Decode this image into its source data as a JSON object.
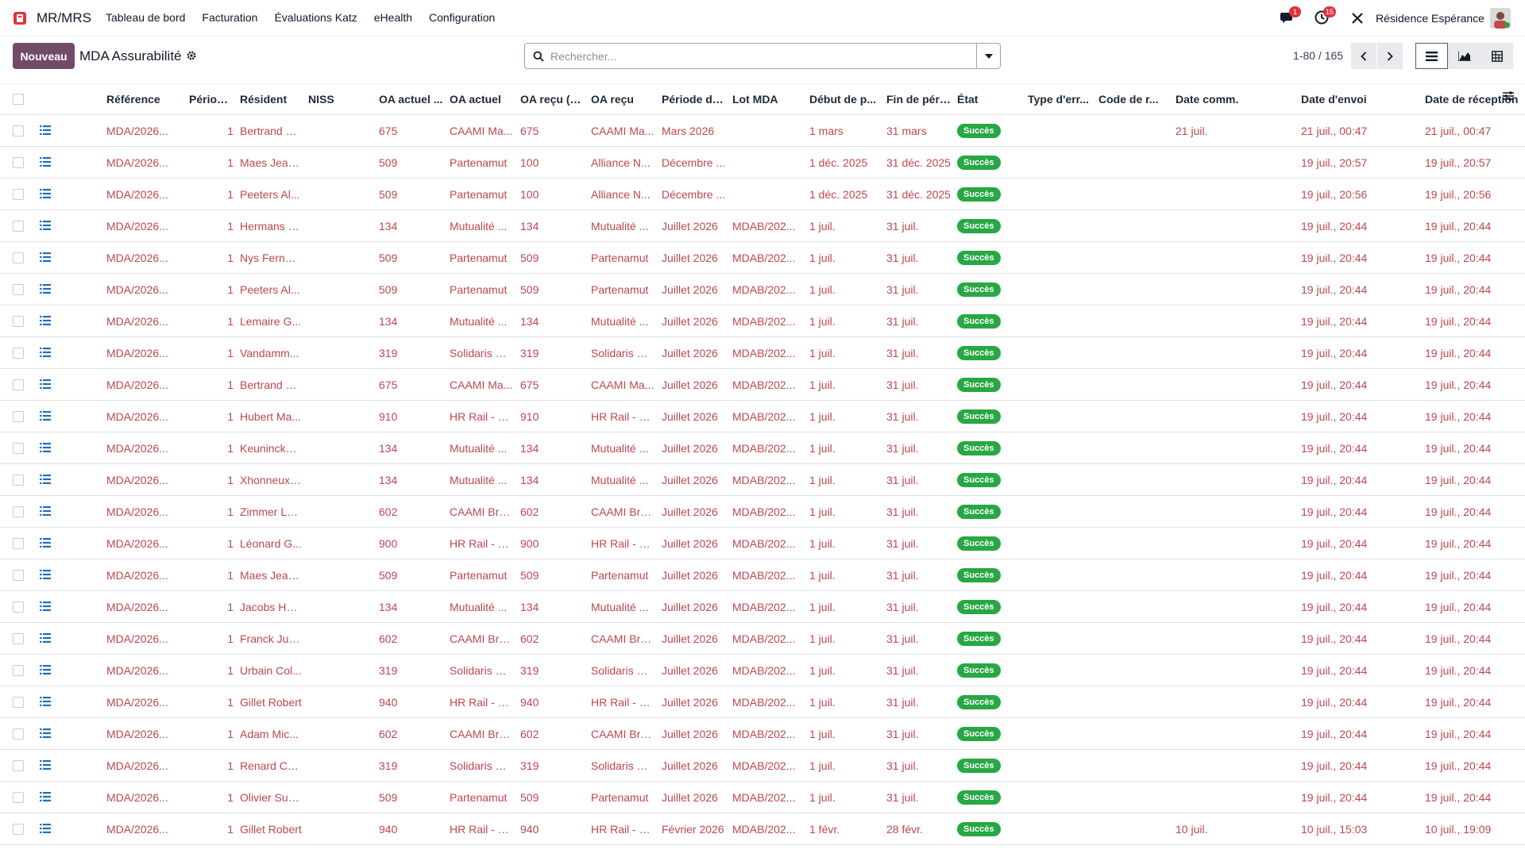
{
  "navbar": {
    "app_name": "MR/MRS",
    "menu": [
      "Tableau de bord",
      "Facturation",
      "Évaluations Katz",
      "eHealth",
      "Configuration"
    ],
    "messages_badge": "1",
    "activities_badge": "15",
    "company": "Résidence Espérance",
    "icons": {
      "brand": "#714b67",
      "badge": "#e0323c"
    }
  },
  "control": {
    "new_label": "Nouveau",
    "breadcrumb": "MDA Assurabilité",
    "search_placeholder": "Rechercher...",
    "pager": "1-80 / 165"
  },
  "columns": [
    "Référence",
    "Périodes",
    "Résident",
    "NISS",
    "OA actuel ...",
    "OA actuel",
    "OA reçu (c...",
    "OA reçu",
    "Période de...",
    "Lot MDA",
    "Début de p...",
    "Fin de pério...",
    "État",
    "Type d'err...",
    "Code de r...",
    "Date comm.",
    "Date d'envoi",
    "Date de réception"
  ],
  "rows": [
    {
      "ref": "MDA/2026...",
      "per": "1",
      "res": "Bertrand G...",
      "niss": "",
      "oa_code": "675",
      "oa": "CAAMI Ma...",
      "oa_recu_code": "675",
      "oa_recu": "CAAMI Ma...",
      "periode": "Mars 2026",
      "lot": "",
      "debut": "1 mars",
      "fin": "31 mars",
      "etat": "Succès",
      "type": "",
      "code": "",
      "comm": "21 juil.",
      "envoi": "21 juil., 00:47",
      "recep": "21 juil., 00:47"
    },
    {
      "ref": "MDA/2026...",
      "per": "1",
      "res": "Maes Jeanne",
      "niss": "",
      "oa_code": "509",
      "oa": "Partenamut",
      "oa_recu_code": "100",
      "oa_recu": "Alliance N...",
      "periode": "Décembre ...",
      "lot": "",
      "debut": "1 déc. 2025",
      "fin": "31 déc. 2025",
      "etat": "Succès",
      "type": "",
      "code": "",
      "comm": "",
      "envoi": "19 juil., 20:57",
      "recep": "19 juil., 20:57"
    },
    {
      "ref": "MDA/2026...",
      "per": "1",
      "res": "Peeters Al...",
      "niss": "",
      "oa_code": "509",
      "oa": "Partenamut",
      "oa_recu_code": "100",
      "oa_recu": "Alliance N...",
      "periode": "Décembre ...",
      "lot": "",
      "debut": "1 déc. 2025",
      "fin": "31 déc. 2025",
      "etat": "Succès",
      "type": "",
      "code": "",
      "comm": "",
      "envoi": "19 juil., 20:56",
      "recep": "19 juil., 20:56"
    },
    {
      "ref": "MDA/2026...",
      "per": "1",
      "res": "Hermans P...",
      "niss": "",
      "oa_code": "134",
      "oa": "Mutualité ...",
      "oa_recu_code": "134",
      "oa_recu": "Mutualité ...",
      "periode": "Juillet 2026",
      "lot": "MDAB/202...",
      "debut": "1 juil.",
      "fin": "31 juil.",
      "etat": "Succès",
      "type": "",
      "code": "",
      "comm": "",
      "envoi": "19 juil., 20:44",
      "recep": "19 juil., 20:44"
    },
    {
      "ref": "MDA/2026...",
      "per": "1",
      "res": "Nys Fernand",
      "niss": "",
      "oa_code": "509",
      "oa": "Partenamut",
      "oa_recu_code": "509",
      "oa_recu": "Partenamut",
      "periode": "Juillet 2026",
      "lot": "MDAB/202...",
      "debut": "1 juil.",
      "fin": "31 juil.",
      "etat": "Succès",
      "type": "",
      "code": "",
      "comm": "",
      "envoi": "19 juil., 20:44",
      "recep": "19 juil., 20:44"
    },
    {
      "ref": "MDA/2026...",
      "per": "1",
      "res": "Peeters Al...",
      "niss": "",
      "oa_code": "509",
      "oa": "Partenamut",
      "oa_recu_code": "509",
      "oa_recu": "Partenamut",
      "periode": "Juillet 2026",
      "lot": "MDAB/202...",
      "debut": "1 juil.",
      "fin": "31 juil.",
      "etat": "Succès",
      "type": "",
      "code": "",
      "comm": "",
      "envoi": "19 juil., 20:44",
      "recep": "19 juil., 20:44"
    },
    {
      "ref": "MDA/2026...",
      "per": "1",
      "res": "Lemaire G...",
      "niss": "",
      "oa_code": "134",
      "oa": "Mutualité ...",
      "oa_recu_code": "134",
      "oa_recu": "Mutualité ...",
      "periode": "Juillet 2026",
      "lot": "MDAB/202...",
      "debut": "1 juil.",
      "fin": "31 juil.",
      "etat": "Succès",
      "type": "",
      "code": "",
      "comm": "",
      "envoi": "19 juil., 20:44",
      "recep": "19 juil., 20:44"
    },
    {
      "ref": "MDA/2026...",
      "per": "1",
      "res": "Vandamm...",
      "niss": "",
      "oa_code": "319",
      "oa": "Solidaris W...",
      "oa_recu_code": "319",
      "oa_recu": "Solidaris W...",
      "periode": "Juillet 2026",
      "lot": "MDAB/202...",
      "debut": "1 juil.",
      "fin": "31 juil.",
      "etat": "Succès",
      "type": "",
      "code": "",
      "comm": "",
      "envoi": "19 juil., 20:44",
      "recep": "19 juil., 20:44"
    },
    {
      "ref": "MDA/2026...",
      "per": "1",
      "res": "Bertrand G...",
      "niss": "",
      "oa_code": "675",
      "oa": "CAAMI Ma...",
      "oa_recu_code": "675",
      "oa_recu": "CAAMI Ma...",
      "periode": "Juillet 2026",
      "lot": "MDAB/202...",
      "debut": "1 juil.",
      "fin": "31 juil.",
      "etat": "Succès",
      "type": "",
      "code": "",
      "comm": "",
      "envoi": "19 juil., 20:44",
      "recep": "19 juil., 20:44"
    },
    {
      "ref": "MDA/2026...",
      "per": "1",
      "res": "Hubert Ma...",
      "niss": "",
      "oa_code": "910",
      "oa": "HR Rail - C...",
      "oa_recu_code": "910",
      "oa_recu": "HR Rail - C...",
      "periode": "Juillet 2026",
      "lot": "MDAB/202...",
      "debut": "1 juil.",
      "fin": "31 juil.",
      "etat": "Succès",
      "type": "",
      "code": "",
      "comm": "",
      "envoi": "19 juil., 20:44",
      "recep": "19 juil., 20:44"
    },
    {
      "ref": "MDA/2026...",
      "per": "1",
      "res": "Keuninckx ...",
      "niss": "",
      "oa_code": "134",
      "oa": "Mutualité ...",
      "oa_recu_code": "134",
      "oa_recu": "Mutualité ...",
      "periode": "Juillet 2026",
      "lot": "MDAB/202...",
      "debut": "1 juil.",
      "fin": "31 juil.",
      "etat": "Succès",
      "type": "",
      "code": "",
      "comm": "",
      "envoi": "19 juil., 20:44",
      "recep": "19 juil., 20:44"
    },
    {
      "ref": "MDA/2026...",
      "per": "1",
      "res": "Xhonneux ...",
      "niss": "",
      "oa_code": "134",
      "oa": "Mutualité ...",
      "oa_recu_code": "134",
      "oa_recu": "Mutualité ...",
      "periode": "Juillet 2026",
      "lot": "MDAB/202...",
      "debut": "1 juil.",
      "fin": "31 juil.",
      "etat": "Succès",
      "type": "",
      "code": "",
      "comm": "",
      "envoi": "19 juil., 20:44",
      "recep": "19 juil., 20:44"
    },
    {
      "ref": "MDA/2026...",
      "per": "1",
      "res": "Zimmer Lé...",
      "niss": "",
      "oa_code": "602",
      "oa": "CAAMI Bru...",
      "oa_recu_code": "602",
      "oa_recu": "CAAMI Bru...",
      "periode": "Juillet 2026",
      "lot": "MDAB/202...",
      "debut": "1 juil.",
      "fin": "31 juil.",
      "etat": "Succès",
      "type": "",
      "code": "",
      "comm": "",
      "envoi": "19 juil., 20:44",
      "recep": "19 juil., 20:44"
    },
    {
      "ref": "MDA/2026...",
      "per": "1",
      "res": "Léonard G...",
      "niss": "",
      "oa_code": "900",
      "oa": "HR Rail - C...",
      "oa_recu_code": "900",
      "oa_recu": "HR Rail - C...",
      "periode": "Juillet 2026",
      "lot": "MDAB/202...",
      "debut": "1 juil.",
      "fin": "31 juil.",
      "etat": "Succès",
      "type": "",
      "code": "",
      "comm": "",
      "envoi": "19 juil., 20:44",
      "recep": "19 juil., 20:44"
    },
    {
      "ref": "MDA/2026...",
      "per": "1",
      "res": "Maes Jeanne",
      "niss": "",
      "oa_code": "509",
      "oa": "Partenamut",
      "oa_recu_code": "509",
      "oa_recu": "Partenamut",
      "periode": "Juillet 2026",
      "lot": "MDAB/202...",
      "debut": "1 juil.",
      "fin": "31 juil.",
      "etat": "Succès",
      "type": "",
      "code": "",
      "comm": "",
      "envoi": "19 juil., 20:44",
      "recep": "19 juil., 20:44"
    },
    {
      "ref": "MDA/2026...",
      "per": "1",
      "res": "Jacobs Henri",
      "niss": "",
      "oa_code": "134",
      "oa": "Mutualité ...",
      "oa_recu_code": "134",
      "oa_recu": "Mutualité ...",
      "periode": "Juillet 2026",
      "lot": "MDAB/202...",
      "debut": "1 juil.",
      "fin": "31 juil.",
      "etat": "Succès",
      "type": "",
      "code": "",
      "comm": "",
      "envoi": "19 juil., 20:44",
      "recep": "19 juil., 20:44"
    },
    {
      "ref": "MDA/2026...",
      "per": "1",
      "res": "Franck Julien",
      "niss": "",
      "oa_code": "602",
      "oa": "CAAMI Bru...",
      "oa_recu_code": "602",
      "oa_recu": "CAAMI Bru...",
      "periode": "Juillet 2026",
      "lot": "MDAB/202...",
      "debut": "1 juil.",
      "fin": "31 juil.",
      "etat": "Succès",
      "type": "",
      "code": "",
      "comm": "",
      "envoi": "19 juil., 20:44",
      "recep": "19 juil., 20:44"
    },
    {
      "ref": "MDA/2026...",
      "per": "1",
      "res": "Urbain Col...",
      "niss": "",
      "oa_code": "319",
      "oa": "Solidaris W...",
      "oa_recu_code": "319",
      "oa_recu": "Solidaris W...",
      "periode": "Juillet 2026",
      "lot": "MDAB/202...",
      "debut": "1 juil.",
      "fin": "31 juil.",
      "etat": "Succès",
      "type": "",
      "code": "",
      "comm": "",
      "envoi": "19 juil., 20:44",
      "recep": "19 juil., 20:44"
    },
    {
      "ref": "MDA/2026...",
      "per": "1",
      "res": "Gillet Robert",
      "niss": "",
      "oa_code": "940",
      "oa": "HR Rail - C...",
      "oa_recu_code": "940",
      "oa_recu": "HR Rail - C...",
      "periode": "Juillet 2026",
      "lot": "MDAB/202...",
      "debut": "1 juil.",
      "fin": "31 juil.",
      "etat": "Succès",
      "type": "",
      "code": "",
      "comm": "",
      "envoi": "19 juil., 20:44",
      "recep": "19 juil., 20:44"
    },
    {
      "ref": "MDA/2026...",
      "per": "1",
      "res": "Adam Mic...",
      "niss": "",
      "oa_code": "602",
      "oa": "CAAMI Bru...",
      "oa_recu_code": "602",
      "oa_recu": "CAAMI Bru...",
      "periode": "Juillet 2026",
      "lot": "MDAB/202...",
      "debut": "1 juil.",
      "fin": "31 juil.",
      "etat": "Succès",
      "type": "",
      "code": "",
      "comm": "",
      "envoi": "19 juil., 20:44",
      "recep": "19 juil., 20:44"
    },
    {
      "ref": "MDA/2026...",
      "per": "1",
      "res": "Renard Ca...",
      "niss": "",
      "oa_code": "319",
      "oa": "Solidaris W...",
      "oa_recu_code": "319",
      "oa_recu": "Solidaris W...",
      "periode": "Juillet 2026",
      "lot": "MDAB/202...",
      "debut": "1 juil.",
      "fin": "31 juil.",
      "etat": "Succès",
      "type": "",
      "code": "",
      "comm": "",
      "envoi": "19 juil., 20:44",
      "recep": "19 juil., 20:44"
    },
    {
      "ref": "MDA/2026...",
      "per": "1",
      "res": "Olivier Suz...",
      "niss": "",
      "oa_code": "509",
      "oa": "Partenamut",
      "oa_recu_code": "509",
      "oa_recu": "Partenamut",
      "periode": "Juillet 2026",
      "lot": "MDAB/202...",
      "debut": "1 juil.",
      "fin": "31 juil.",
      "etat": "Succès",
      "type": "",
      "code": "",
      "comm": "",
      "envoi": "19 juil., 20:44",
      "recep": "19 juil., 20:44"
    },
    {
      "ref": "MDA/2026...",
      "per": "1",
      "res": "Gillet Robert",
      "niss": "",
      "oa_code": "940",
      "oa": "HR Rail - C...",
      "oa_recu_code": "940",
      "oa_recu": "HR Rail - C...",
      "periode": "Février 2026",
      "lot": "MDAB/202...",
      "debut": "1 févr.",
      "fin": "28 févr.",
      "etat": "Succès",
      "type": "",
      "code": "",
      "comm": "10 juil.",
      "envoi": "10 juil., 15:03",
      "recep": "10 juil., 19:09"
    }
  ],
  "colors": {
    "link": "#c0464e",
    "success": "#28a745",
    "primary": "#714b67"
  }
}
